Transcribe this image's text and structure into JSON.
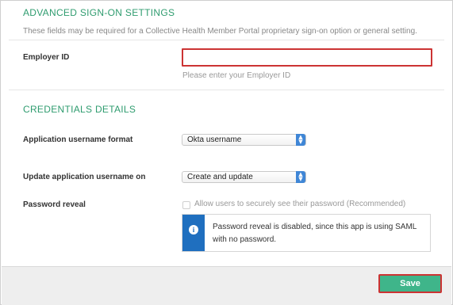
{
  "advanced": {
    "title": "ADVANCED SIGN-ON SETTINGS",
    "description": "These fields may be required for a Collective Health Member Portal proprietary sign-on option or general setting.",
    "employer_id": {
      "label": "Employer ID",
      "value": "",
      "hint": "Please enter your Employer ID"
    }
  },
  "credentials": {
    "title": "CREDENTIALS DETAILS",
    "username_format": {
      "label": "Application username format",
      "selected": "Okta username"
    },
    "update_username": {
      "label": "Update application username on",
      "selected": "Create and update"
    },
    "password_reveal": {
      "label": "Password reveal",
      "checkbox_label": "Allow users to securely see their password (Recommended)",
      "checked": false,
      "info_message": "Password reveal is disabled, since this app is using SAML with no password."
    }
  },
  "footer": {
    "save_label": "Save"
  },
  "colors": {
    "accent_green": "#3fb58a",
    "title_green": "#2f9c6f",
    "highlight_red": "#cc3333",
    "info_blue": "#1f6fbf"
  }
}
